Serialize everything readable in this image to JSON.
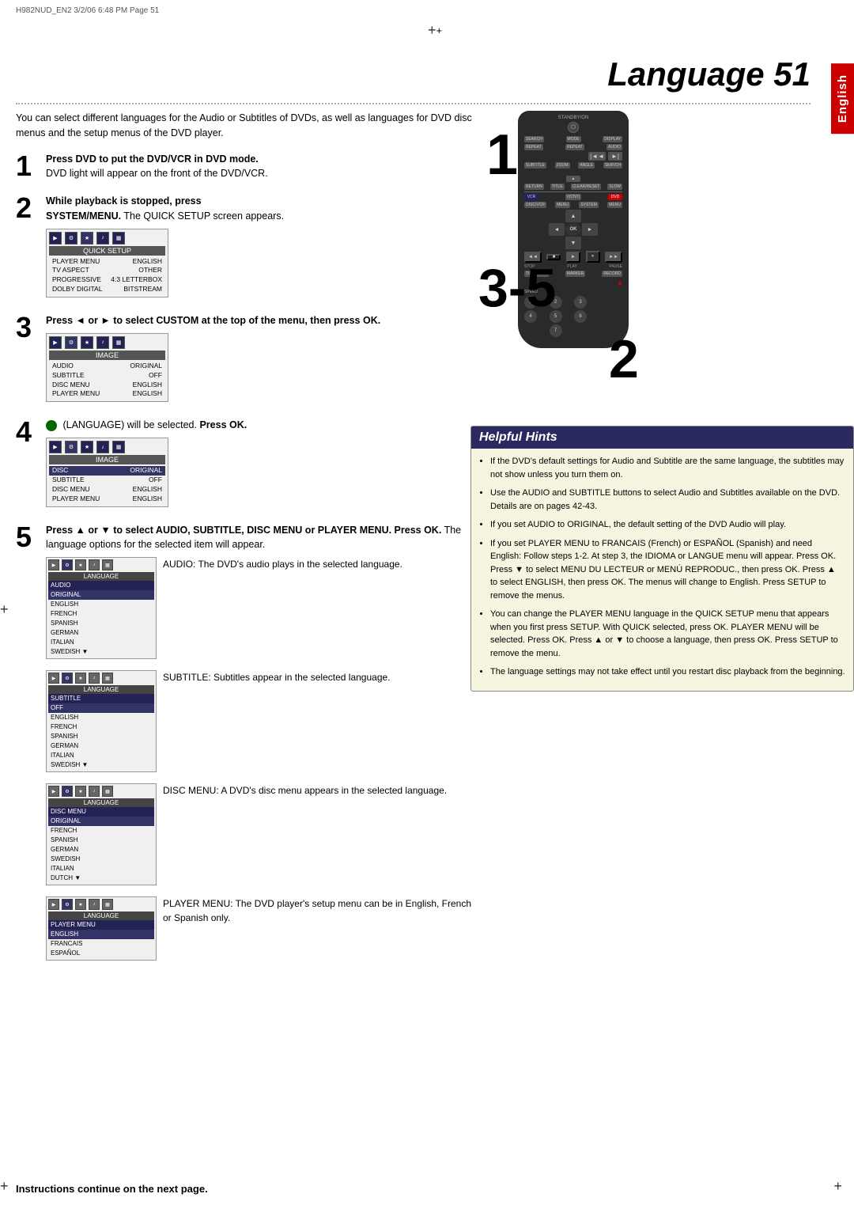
{
  "header": {
    "file_info": "H982NUD_EN2  3/2/06  6:48 PM  Page 51"
  },
  "page_title": "Language 51",
  "english_tab": "English",
  "intro": {
    "text": "You can select different languages for the Audio or Subtitles of DVDs, as well as languages for DVD disc menus and the setup menus of the DVD player."
  },
  "steps": [
    {
      "number": "1",
      "heading": "Press DVD to put the DVD/VCR in DVD mode.",
      "body": "DVD light will appear on the front of the DVD/VCR."
    },
    {
      "number": "2",
      "heading": "While playback is stopped, press SYSTEM/MENU.",
      "body": "The QUICK SETUP screen appears."
    },
    {
      "number": "3",
      "heading": "Press ◄ or ► to select CUSTOM at the top of the menu, then press OK."
    },
    {
      "number": "4",
      "heading": "(LANGUAGE) will be selected. Press OK."
    },
    {
      "number": "5",
      "heading": "Press ▲ or ▼ to select AUDIO, SUBTITLE, DISC MENU or PLAYER MENU. Press OK.",
      "body": "The language options for the selected item will appear."
    }
  ],
  "sub_items": [
    {
      "label": "AUDIO",
      "text": "AUDIO: The DVD's audio plays in the selected language."
    },
    {
      "label": "SUBTITLE",
      "text": "SUBTITLE: Subtitles appear in the selected language."
    },
    {
      "label": "DISC MENU",
      "text": "DISC MENU: A DVD's disc menu appears in the selected language."
    },
    {
      "label": "PLAYER MENU",
      "text": "PLAYER MENU: The DVD player's setup menu can be in English, French or Spanish only."
    }
  ],
  "helpful_hints": {
    "title": "Helpful Hints",
    "items": [
      "If the DVD's default settings for Audio and Subtitle are the same language, the subtitles may not show unless you turn them on.",
      "Use the AUDIO and SUBTITLE buttons to select Audio and Subtitles available on the DVD. Details are on pages 42-43.",
      "If you set AUDIO to ORIGINAL, the default setting of the DVD Audio will play.",
      "If you set PLAYER MENU to FRANCAIS (French) or ESPAÑOL (Spanish) and need English: Follow steps 1-2. At step 3, the IDIOMA or LANGUE menu will appear. Press OK. Press ▼ to select MENU DU LECTEUR or MENÚ REPRODUC., then press OK. Press ▲ to select ENGLISH, then press OK. The menus will change to English. Press SETUP to remove the menus.",
      "You can change the PLAYER MENU language in the QUICK SETUP menu that appears when you first press SETUP. With QUICK selected, press OK. PLAYER MENU will be selected. Press OK. Press ▲ or ▼ to choose a language, then press OK. Press SETUP to remove the menu.",
      "The language settings may not take effect until you restart disc playback from the beginning."
    ]
  },
  "instructions_footer": "Instructions continue on the next page.",
  "remote": {
    "standby_label": "STANDBY/ON",
    "buttons": [
      "SEARCH",
      "MODE",
      "DISPLAY",
      "REPEAT",
      "REPEAT",
      "AUDIO",
      "SUBTITLE",
      "ZOOM",
      "ANGLE",
      "SKIP/CH",
      "RETURN",
      "TITLE",
      "CLEAR/RESET",
      "SLOW",
      "VCR",
      "V(CNT)",
      "DVD",
      "DISC/VCR",
      "SYSTEM",
      "STOP",
      "PLAY",
      "PAUSE",
      "TIMER SET",
      "MARKER",
      "RECORD",
      "SPEED"
    ]
  }
}
